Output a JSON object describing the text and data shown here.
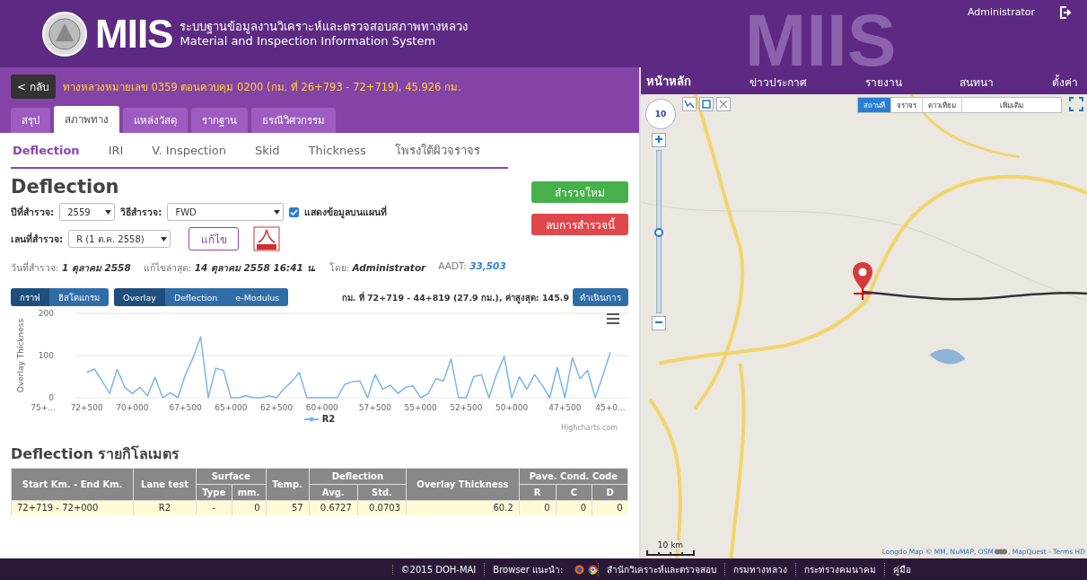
{
  "header": {
    "logo_text": "MIIS",
    "title_th": "ระบบฐานข้อมูลงานวิเคราะห์และตรวจสอบสภาพทางหลวง",
    "title_en": "Material and Inspection Information System",
    "user": "Administrator",
    "backdrop_text": "MIIS"
  },
  "nav": [
    {
      "label": "หน้าหลัก",
      "selected": true
    },
    {
      "label": "ข่าวประกาศ",
      "selected": false
    },
    {
      "label": "รายงาน",
      "selected": false
    },
    {
      "label": "สนทนา",
      "selected": false
    },
    {
      "label": "ตั้งค่า",
      "selected": false
    }
  ],
  "road_bar": {
    "back": "< กลับ",
    "title": "ทางหลวงหมายเลข 0359 ตอนควบคุม 0200 (กม. ที่ 26+793 - 72+719), 45.926 กม."
  },
  "tabs": [
    {
      "label": "สรุป",
      "selected": false
    },
    {
      "label": "สภาพทาง",
      "selected": true
    },
    {
      "label": "แหล่งวัสดุ",
      "selected": false
    },
    {
      "label": "รากฐาน",
      "selected": false
    },
    {
      "label": "ธรณีวิศวกรรม",
      "selected": false
    }
  ],
  "subtabs": [
    {
      "label": "Deflection",
      "selected": true
    },
    {
      "label": "IRI",
      "selected": false
    },
    {
      "label": "V. Inspection",
      "selected": false
    },
    {
      "label": "Skid",
      "selected": false
    },
    {
      "label": "Thickness",
      "selected": false
    },
    {
      "label": "โพรงใต้ผิวจราจร",
      "selected": false
    }
  ],
  "section_title": "Deflection",
  "actions": [
    {
      "label": "สำรวจใหม่",
      "kind": "create"
    },
    {
      "label": "ลบการสำรวจนี้",
      "kind": "delete"
    }
  ],
  "filters": {
    "year": {
      "label": "ปีที่สำรวจ:",
      "value": "2559"
    },
    "method": {
      "label": "วิธีสำรวจ:",
      "value": "FWD"
    },
    "show_on_map": {
      "label": "แสดงข้อมูลบนแผนที่",
      "checked": true
    },
    "lane": {
      "label": "เลนที่สำรวจ:",
      "value": "R (1 ต.ค. 2558)"
    },
    "edit": "แก้ไข"
  },
  "info": [
    {
      "label": "วันที่สำรวจ:",
      "value": "1 ตุลาคม 2558",
      "kind": "text"
    },
    {
      "label": "แก้ไขล่าสุด:",
      "value": "14 ตุลาคม 2558 16:41 น.",
      "kind": "text"
    },
    {
      "label": "โดย:",
      "value": "Administrator",
      "kind": "text"
    },
    {
      "label": "AADT:",
      "value": "33,503",
      "kind": "link"
    }
  ],
  "view_modes": [
    {
      "label": "กราฟ",
      "selected": true
    },
    {
      "label": "ฮิสโตแกรม",
      "selected": false
    }
  ],
  "series_modes": [
    {
      "label": "Overlay",
      "selected": true
    },
    {
      "label": "Deflection",
      "selected": false
    },
    {
      "label": "e-Modulus",
      "selected": false
    }
  ],
  "range_text": "กม. ที่ 72+719 - 44+819 (27.9 กม.), ค่าสูงสุด: 145.9",
  "run_button": "ดำเนินการ",
  "chart": {
    "credit": "Highcharts.com",
    "chart_data": {
      "type": "line",
      "ylabel": "Overlay Thickness",
      "ylim": [
        0,
        200
      ],
      "yticks": [
        0,
        100,
        200
      ],
      "categories": [
        "75+...",
        null,
        null,
        null,
        null,
        null,
        "72+500",
        null,
        null,
        null,
        null,
        null,
        "70+000",
        null,
        null,
        null,
        null,
        null,
        null,
        "67+500",
        null,
        null,
        null,
        null,
        null,
        "65+000",
        null,
        null,
        null,
        null,
        null,
        "62+500",
        null,
        null,
        null,
        null,
        null,
        "60+000",
        null,
        null,
        null,
        null,
        null,
        null,
        "57+500",
        null,
        null,
        null,
        null,
        null,
        "55+000",
        null,
        null,
        null,
        null,
        null,
        "52+500",
        null,
        null,
        null,
        null,
        null,
        "50+000",
        null,
        null,
        null,
        null,
        null,
        null,
        "47+500",
        null,
        null,
        null,
        null,
        null,
        "45+0..."
      ],
      "series": [
        {
          "name": "R2",
          "color": "#7cb5ec",
          "values": [
            null,
            null,
            null,
            null,
            null,
            null,
            60,
            68,
            40,
            10,
            67,
            25,
            10,
            25,
            5,
            48,
            0,
            12,
            0,
            55,
            95,
            145,
            0,
            70,
            65,
            0,
            0,
            5,
            0,
            0,
            5,
            0,
            22,
            38,
            60,
            0,
            0,
            0,
            0,
            0,
            32,
            38,
            40,
            0,
            55,
            20,
            30,
            10,
            25,
            28,
            0,
            10,
            45,
            40,
            92,
            0,
            0,
            50,
            55,
            0,
            55,
            98,
            0,
            50,
            20,
            55,
            30,
            0,
            72,
            0,
            95,
            45,
            65,
            0,
            52,
            108
          ]
        }
      ]
    }
  },
  "table": {
    "title": "Deflection รายกิโลเมตร",
    "columns": [
      {
        "label": "Start Km. - End Km."
      },
      {
        "label": "Lane test"
      },
      {
        "label": "Surface",
        "colspan": 2,
        "children": [
          "Type",
          "mm."
        ]
      },
      {
        "label": "Temp."
      },
      {
        "label": "Deflection",
        "colspan": 2,
        "children": [
          "Avg.",
          "Std."
        ]
      },
      {
        "label": "Overlay Thickness"
      },
      {
        "label": "Pave. Cond. Code",
        "colspan": 3,
        "children": [
          "R",
          "C",
          "D"
        ]
      }
    ],
    "rows": [
      [
        "72+719 - 72+000",
        "R2",
        "-",
        "0",
        "57",
        "0.6727",
        "0.0703",
        "60.2",
        "0",
        "0",
        "0"
      ]
    ]
  },
  "map": {
    "zoom": "10",
    "zoom_slider": {
      "level": 0.5
    },
    "layers": [
      {
        "label": "สถานที่",
        "selected": true
      },
      {
        "label": "จราจร",
        "selected": false
      },
      {
        "label": "ดาวเทียม",
        "selected": false
      }
    ],
    "more": "เพิ่มเติม",
    "scale": "10 km",
    "attribution_before": "Longdo Map © MM, NuMAP, OSM",
    "attribution_after": ", MapQuest - Terms HD"
  },
  "footer": [
    {
      "label": "©2015 DOH-MAI",
      "kind": "text"
    },
    {
      "label": "Browser แนะนำ:",
      "kind": "browsers"
    },
    {
      "label": "สำนักวิเคราะห์และตรวจสอบ",
      "kind": "text"
    },
    {
      "label": "กรมทางหลวง",
      "kind": "text"
    },
    {
      "label": "กระทรวงคมนาคม",
      "kind": "text"
    },
    {
      "label": "คู่มือ",
      "kind": "text"
    }
  ]
}
